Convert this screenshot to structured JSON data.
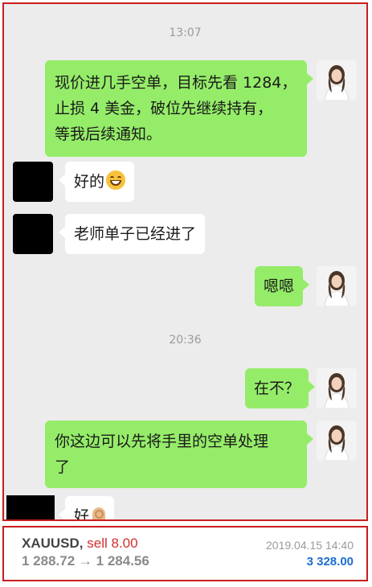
{
  "chat": {
    "timestamps": [
      "13:07",
      "20:36"
    ],
    "messages": [
      {
        "from": "teacher",
        "lines": [
          "现价进几手空单，目标先看 1284，",
          "止损 4 美金，破位先继续持有，",
          "等我后续通知。"
        ]
      },
      {
        "from": "user",
        "text": "好的",
        "emoji": "grinning-face"
      },
      {
        "from": "user",
        "text": "老师单子已经进了"
      },
      {
        "from": "teacher",
        "text": "嗯嗯"
      },
      {
        "from": "teacher",
        "text": "在不？"
      },
      {
        "from": "teacher",
        "lines": [
          "你这边可以先将手里的空单处理",
          "了"
        ]
      },
      {
        "from": "user",
        "text": "好",
        "emoji": "ok-hand"
      }
    ]
  },
  "trade": {
    "symbol": "XAUUSD,",
    "side_lots": "sell 8.00",
    "open_price": "1 288.72",
    "arrow": "→",
    "close_price": "1 284.56",
    "datetime": "2019.04.15 14:40",
    "profit": "3 328.00"
  },
  "colors": {
    "frame": "#c81e1e",
    "green_bubble": "#95ec69",
    "sell": "#d0312d",
    "profit": "#1c6dd0"
  }
}
